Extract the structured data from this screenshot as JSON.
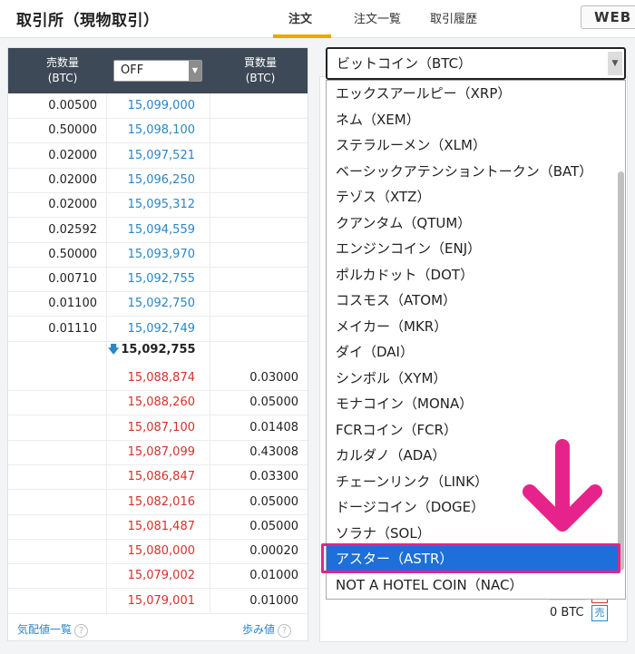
{
  "header": {
    "title": "取引所（現物取引）",
    "tabs": [
      {
        "label": "注文"
      },
      {
        "label": "注文一覧"
      },
      {
        "label": "取引履歴"
      }
    ],
    "web_button": "WEB"
  },
  "book": {
    "sell_qty_header": "売数量\n(BTC)",
    "buy_qty_header": "買数量\n(BTC)",
    "mode_select": "OFF",
    "asks": [
      {
        "qty": "0.00500",
        "price": "15,099,000"
      },
      {
        "qty": "0.50000",
        "price": "15,098,100"
      },
      {
        "qty": "0.02000",
        "price": "15,097,521"
      },
      {
        "qty": "0.02000",
        "price": "15,096,250"
      },
      {
        "qty": "0.02000",
        "price": "15,095,312"
      },
      {
        "qty": "0.02592",
        "price": "15,094,559"
      },
      {
        "qty": "0.50000",
        "price": "15,093,970"
      },
      {
        "qty": "0.00710",
        "price": "15,092,755"
      },
      {
        "qty": "0.01100",
        "price": "15,092,750"
      },
      {
        "qty": "0.01110",
        "price": "15,092,749"
      }
    ],
    "mid_price": "15,092,755",
    "bids": [
      {
        "price": "15,088,874",
        "qty": "0.03000"
      },
      {
        "price": "15,088,260",
        "qty": "0.05000"
      },
      {
        "price": "15,087,100",
        "qty": "0.01408"
      },
      {
        "price": "15,087,099",
        "qty": "0.43008"
      },
      {
        "price": "15,086,847",
        "qty": "0.03300"
      },
      {
        "price": "15,082,016",
        "qty": "0.05000"
      },
      {
        "price": "15,081,487",
        "qty": "0.05000"
      },
      {
        "price": "15,080,000",
        "qty": "0.00020"
      },
      {
        "price": "15,079,002",
        "qty": "0.01000"
      },
      {
        "price": "15,079,001",
        "qty": "0.01000"
      }
    ],
    "footer_left": "気配値一覧",
    "footer_right": "歩み値"
  },
  "coin_select": {
    "value": "ビットコイン（BTC）",
    "options": [
      "エックスアールピー（XRP）",
      "ネム（XEM）",
      "ステラルーメン（XLM）",
      "ベーシックアテンショントークン（BAT）",
      "テゾス（XTZ）",
      "クアンタム（QTUM）",
      "エンジンコイン（ENJ）",
      "ポルカドット（DOT）",
      "コスモス（ATOM）",
      "メイカー（MKR）",
      "ダイ（DAI）",
      "シンボル（XYM）",
      "モナコイン（MONA）",
      "FCRコイン（FCR）",
      "カルダノ（ADA）",
      "チェーンリンク（LINK）",
      "ドージコイン（DOGE）",
      "ソラナ（SOL）",
      "アスター（ASTR）",
      "NOT A HOTEL COIN（NAC）"
    ],
    "selected_index": 18
  },
  "balance": {
    "text": "0 BTC",
    "sell_label": "売"
  },
  "colors": {
    "accent": "#f1a300",
    "ask": "#2b86c6",
    "bid": "#d4322c",
    "highlight": "#e6238a",
    "selected": "#1e6fd9"
  }
}
